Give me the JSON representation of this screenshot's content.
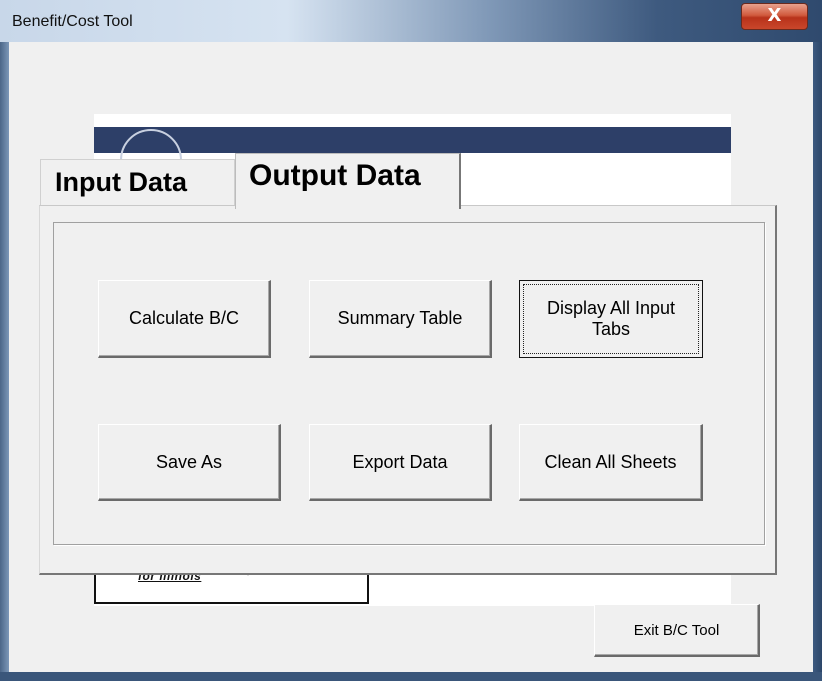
{
  "window": {
    "title": "Benefit/Cost Tool",
    "close_label": "X"
  },
  "banner": {
    "logo_text": "for illinois"
  },
  "tabs": [
    {
      "label": "Input Data",
      "active": false
    },
    {
      "label": "Output Data",
      "active": true
    }
  ],
  "output_panel": {
    "buttons": [
      {
        "label": "Calculate B/C"
      },
      {
        "label": "Summary Table"
      },
      {
        "label": "Display All Input Tabs",
        "focused": true
      },
      {
        "label": "Save As"
      },
      {
        "label": "Export Data"
      },
      {
        "label": "Clean All Sheets"
      }
    ]
  },
  "footer": {
    "exit_label": "Exit B/C Tool"
  },
  "colors": {
    "banner_band": "#2d3f68",
    "close_button": "#c9472b",
    "client_background": "#f0f0f0"
  }
}
